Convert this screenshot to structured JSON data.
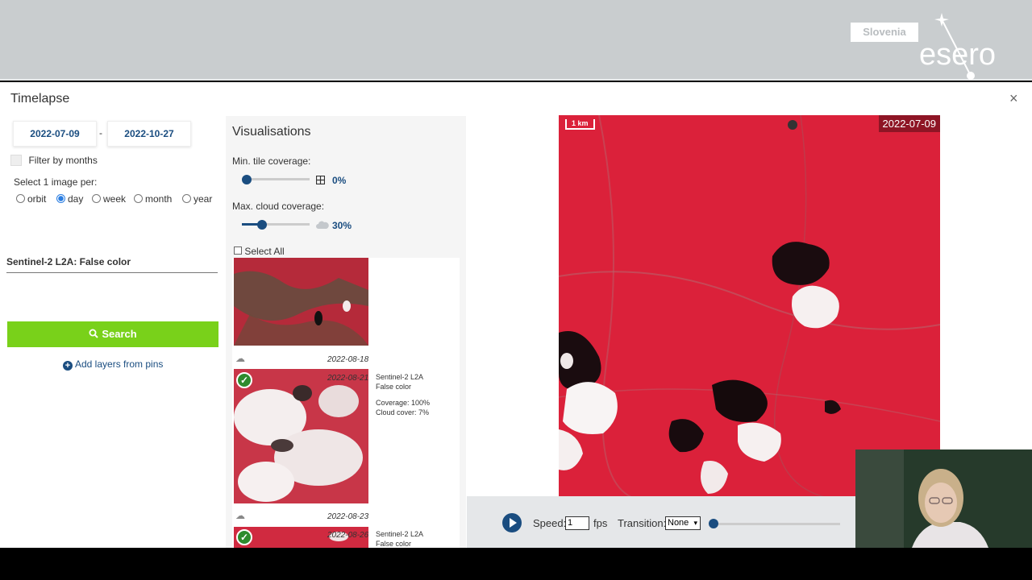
{
  "brand": {
    "region": "Slovenia",
    "logo_text": "esero"
  },
  "modal": {
    "title": "Timelapse",
    "close_glyph": "×"
  },
  "filters": {
    "date_from": "2022-07-09",
    "date_separator": "-",
    "date_to": "2022-10-27",
    "filter_by_months_label": "Filter by months",
    "select_per_label": "Select 1 image per:",
    "options": [
      "orbit",
      "day",
      "week",
      "month",
      "year"
    ],
    "selected_option": "day",
    "layer_name": "Sentinel-2 L2A: False color",
    "search_label": "Search",
    "add_layers_label": "Add layers from pins"
  },
  "visualisations": {
    "title": "Visualisations",
    "min_tile_label": "Min. tile coverage:",
    "min_tile_value": "0%",
    "min_tile_fraction": 0.0,
    "max_cloud_label": "Max. cloud coverage:",
    "max_cloud_value": "30%",
    "max_cloud_fraction": 0.3,
    "select_all_label": "Select All",
    "images": [
      {
        "date": "2022-08-18",
        "selected": false
      },
      {
        "date": "2022-08-21",
        "selected": true,
        "source": "Sentinel-2 L2A",
        "style": "False color",
        "coverage": "Coverage: 100%",
        "cloud": "Cloud cover: 7%"
      },
      {
        "date": "2022-08-23",
        "selected": false
      },
      {
        "date": "2022-08-26",
        "selected": true,
        "source": "Sentinel-2 L2A",
        "style": "False color"
      }
    ]
  },
  "preview": {
    "date": "2022-07-09",
    "scale": "1 km"
  },
  "player": {
    "speed_label": "Speed:",
    "speed_value": "1",
    "fps_label": "fps",
    "transition_label": "Transition:",
    "transition_value": "None",
    "progress_fraction": 0.0
  },
  "colors": {
    "accent": "#1a4d80",
    "search": "#79d11a",
    "false_color": "#e0203a"
  },
  "icons": [
    "close-icon",
    "search-icon",
    "plus-circle-icon",
    "cloud-icon",
    "grid-icon",
    "check-icon",
    "play-icon",
    "chevron-down-icon"
  ]
}
